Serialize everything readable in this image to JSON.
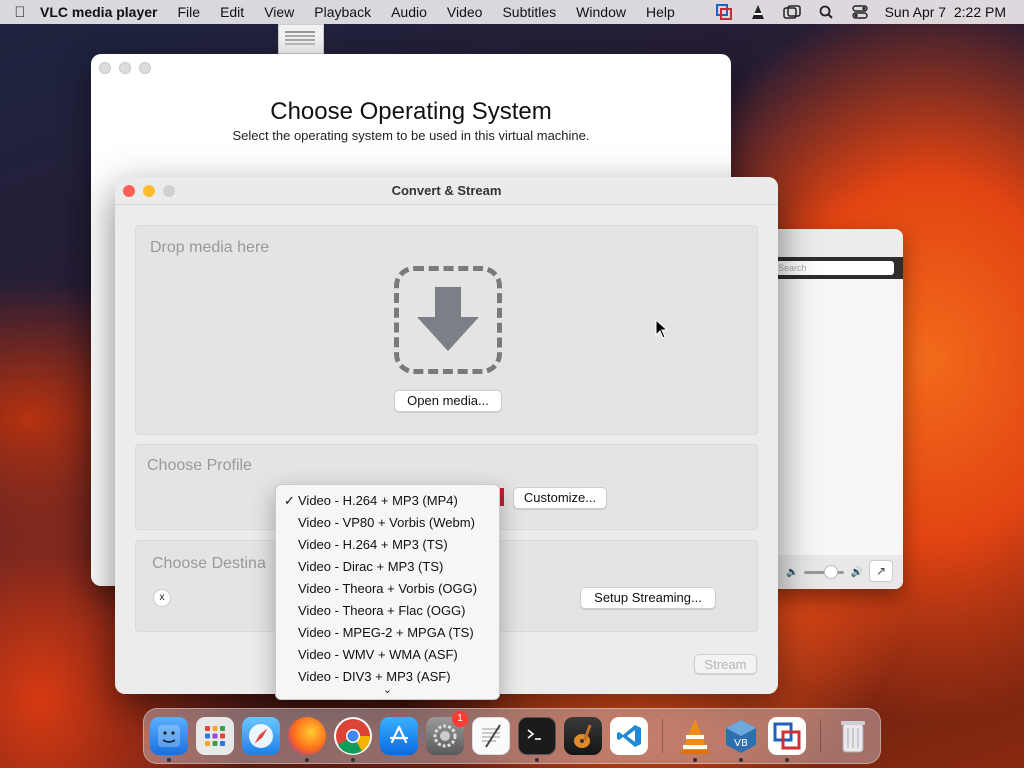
{
  "menubar": {
    "app_name": "VLC media player",
    "items": [
      "File",
      "Edit",
      "View",
      "Playback",
      "Audio",
      "Video",
      "Subtitles",
      "Window",
      "Help"
    ],
    "clock": "Sun Apr 7  2:22 PM"
  },
  "vm_window": {
    "title": "Choose Operating System",
    "subtitle": "Select the operating system to be used in this virtual machine."
  },
  "vlc_window": {
    "search_placeholder": "Search"
  },
  "convert": {
    "title": "Convert & Stream",
    "drop_label": "Drop media here",
    "open_media": "Open media...",
    "profile_label": "Choose Profile",
    "customize": "Customize...",
    "destination_label": "Choose Destina",
    "clear": "x",
    "setup_streaming": "Setup Streaming...",
    "stream": "Stream"
  },
  "dropdown": {
    "selected_index": 0,
    "check": "✓",
    "items": [
      "Video - H.264 + MP3 (MP4)",
      "Video - VP80 + Vorbis (Webm)",
      "Video - H.264 + MP3 (TS)",
      "Video - Dirac + MP3 (TS)",
      "Video - Theora + Vorbis (OGG)",
      "Video - Theora + Flac (OGG)",
      "Video - MPEG-2 + MPGA (TS)",
      "Video - WMV + WMA (ASF)",
      "Video - DIV3 + MP3 (ASF)"
    ],
    "more_glyph": "⌄"
  },
  "dock": {
    "badge_count": "1",
    "apps": [
      "finder-icon",
      "launchpad-icon",
      "safari-icon",
      "firefox-icon",
      "chrome-icon",
      "app-store-icon",
      "system-settings-icon",
      "textedit-icon",
      "terminal-icon",
      "garageband-icon",
      "vscode-icon",
      "vlc-icon",
      "virtualbox-icon",
      "migration-icon",
      "trash-icon"
    ]
  },
  "colors": {
    "accent_red": "#ff5f57",
    "accent_yellow": "#febc2e",
    "vlc_orange": "#f28c18"
  }
}
